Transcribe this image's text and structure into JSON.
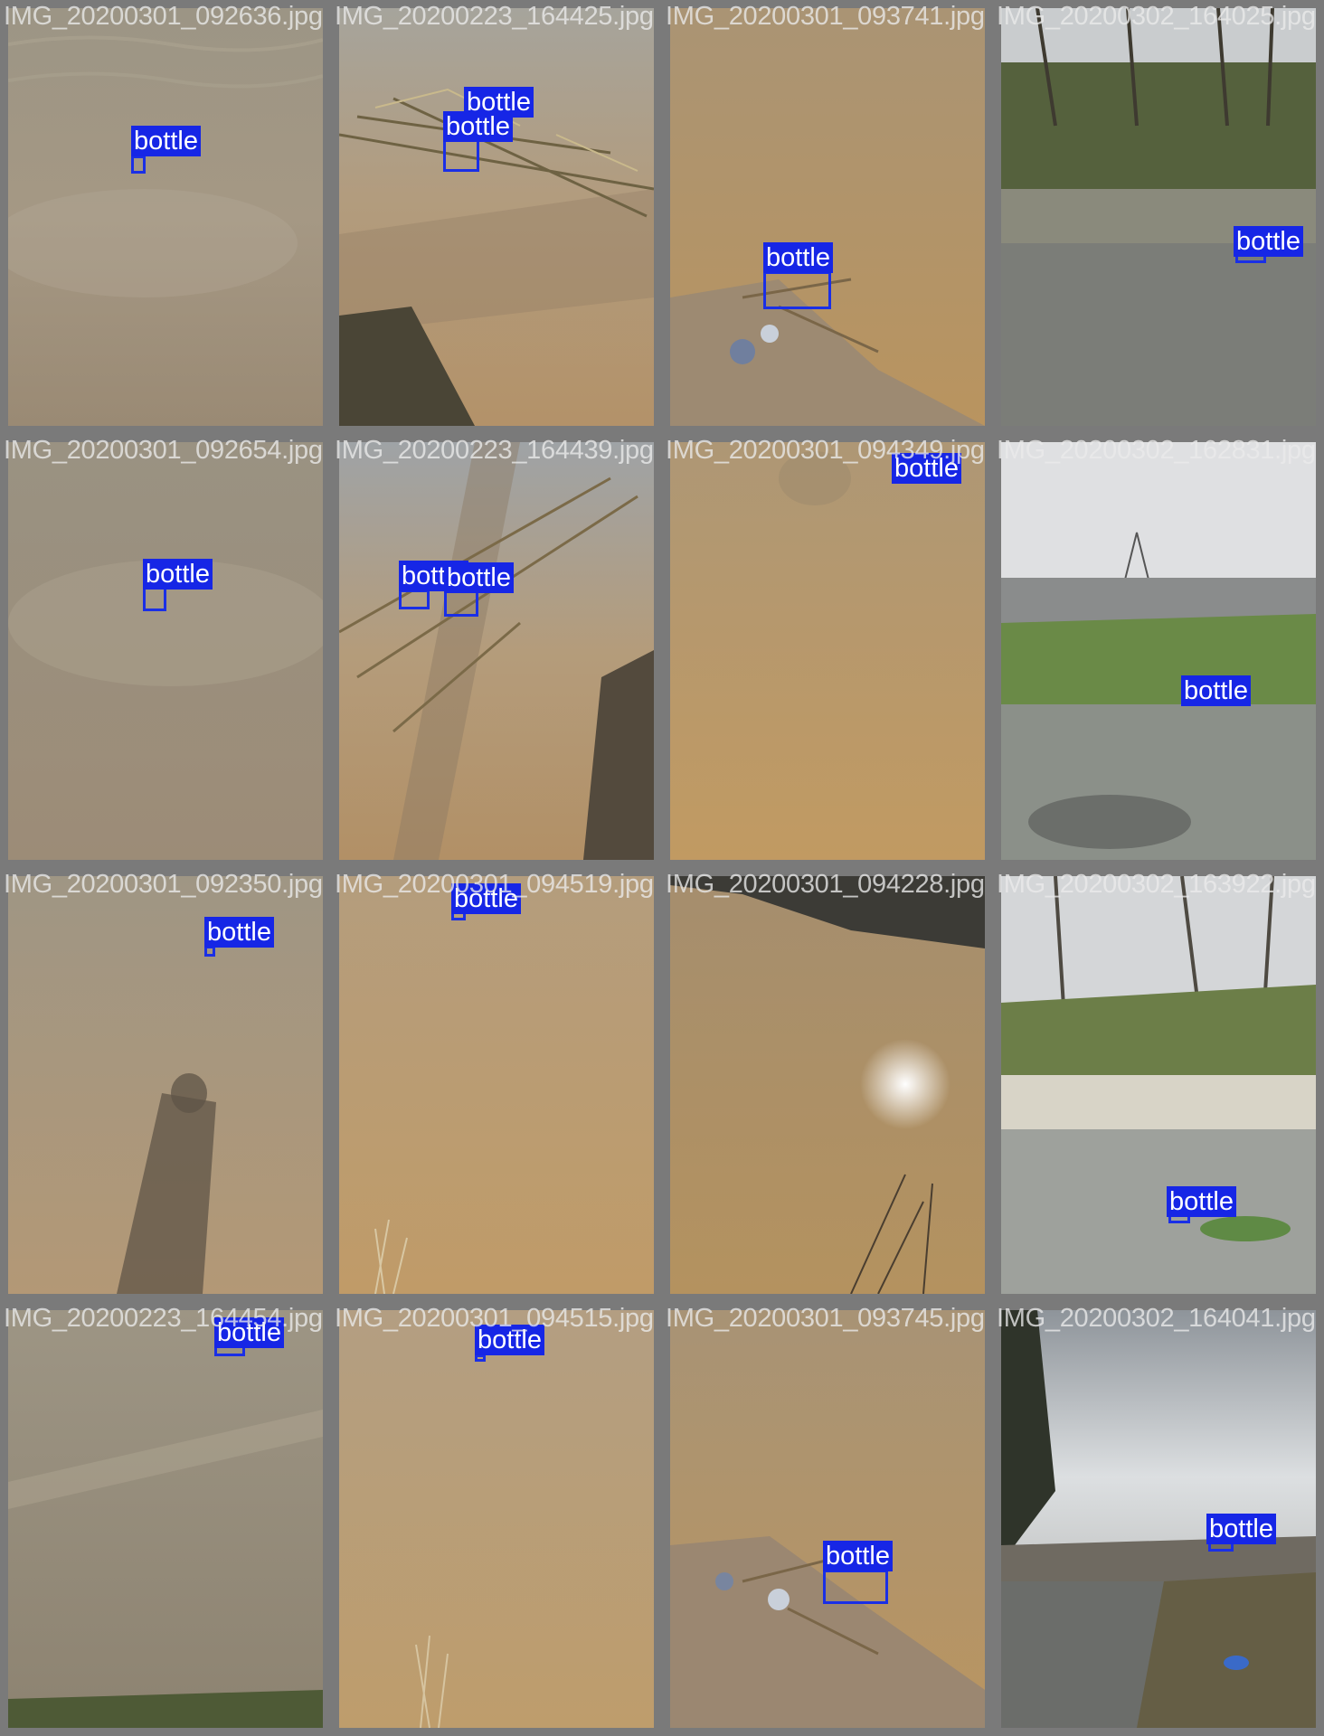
{
  "tiles": [
    {
      "filename": "IMG_20200301_092636.jpg",
      "scene": "grey-water",
      "detections": [
        {
          "label": "bottle"
        }
      ]
    },
    {
      "filename": "IMG_20200223_164425.jpg",
      "scene": "reeds-water",
      "detections": [
        {
          "label": "bottle"
        },
        {
          "label": "bottle"
        }
      ]
    },
    {
      "filename": "IMG_20200301_093741.jpg",
      "scene": "muddy-shore",
      "detections": [
        {
          "label": "bottle"
        }
      ]
    },
    {
      "filename": "IMG_20200302_164025.jpg",
      "scene": "river-trees",
      "detections": [
        {
          "label": "bottle"
        }
      ]
    },
    {
      "filename": "IMG_20200301_092654.jpg",
      "scene": "grey-water",
      "detections": [
        {
          "label": "bottle"
        }
      ]
    },
    {
      "filename": "IMG_20200223_164439.jpg",
      "scene": "reeds-water",
      "detections": [
        {
          "label": "bottle"
        },
        {
          "label": "bottle"
        }
      ]
    },
    {
      "filename": "IMG_20200301_094349.jpg",
      "scene": "brown-water",
      "detections": [
        {
          "label": "bottle"
        }
      ]
    },
    {
      "filename": "IMG_20200302_162831.jpg",
      "scene": "village-river",
      "detections": [
        {
          "label": "bottle"
        }
      ]
    },
    {
      "filename": "IMG_20200301_092350.jpg",
      "scene": "shadow-water",
      "detections": [
        {
          "label": "bottle"
        }
      ]
    },
    {
      "filename": "IMG_20200301_094519.jpg",
      "scene": "brown-water-reeds",
      "detections": [
        {
          "label": "bottle"
        }
      ]
    },
    {
      "filename": "IMG_20200301_094228.jpg",
      "scene": "sun-water",
      "detections": []
    },
    {
      "filename": "IMG_20200302_163922.jpg",
      "scene": "bushes-river",
      "detections": [
        {
          "label": "bottle"
        }
      ]
    },
    {
      "filename": "IMG_20200223_164454.jpg",
      "scene": "grey-water-bank",
      "detections": [
        {
          "label": "bottle"
        }
      ]
    },
    {
      "filename": "IMG_20200301_094515.jpg",
      "scene": "brown-water-reeds",
      "detections": [
        {
          "label": "bottle"
        }
      ]
    },
    {
      "filename": "IMG_20200301_093745.jpg",
      "scene": "muddy-shore",
      "detections": [
        {
          "label": "bottle"
        }
      ]
    },
    {
      "filename": "IMG_20200302_164041.jpg",
      "scene": "sky-river",
      "detections": [
        {
          "label": "bottle"
        }
      ]
    }
  ],
  "colors": {
    "border": "#7a7a7a",
    "box": "#1a2fe6",
    "label_bg": "#1626e6",
    "label_text": "#ffffff"
  }
}
